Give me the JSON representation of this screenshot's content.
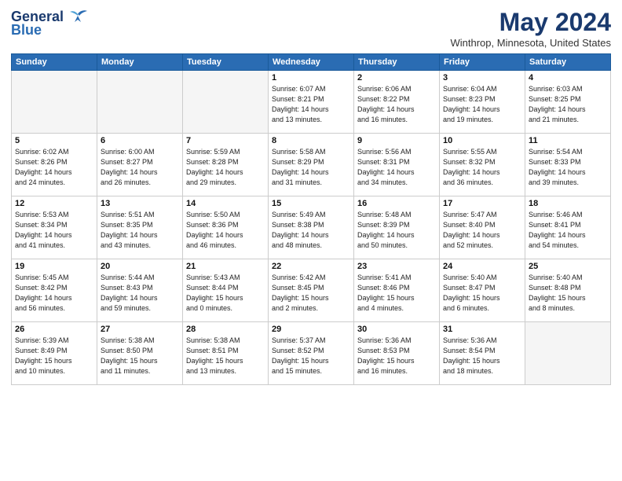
{
  "header": {
    "logo_general": "General",
    "logo_blue": "Blue",
    "month_title": "May 2024",
    "location": "Winthrop, Minnesota, United States"
  },
  "days_of_week": [
    "Sunday",
    "Monday",
    "Tuesday",
    "Wednesday",
    "Thursday",
    "Friday",
    "Saturday"
  ],
  "weeks": [
    [
      {
        "day": "",
        "empty": true
      },
      {
        "day": "",
        "empty": true
      },
      {
        "day": "",
        "empty": true
      },
      {
        "day": "1",
        "lines": [
          "Sunrise: 6:07 AM",
          "Sunset: 8:21 PM",
          "Daylight: 14 hours",
          "and 13 minutes."
        ]
      },
      {
        "day": "2",
        "lines": [
          "Sunrise: 6:06 AM",
          "Sunset: 8:22 PM",
          "Daylight: 14 hours",
          "and 16 minutes."
        ]
      },
      {
        "day": "3",
        "lines": [
          "Sunrise: 6:04 AM",
          "Sunset: 8:23 PM",
          "Daylight: 14 hours",
          "and 19 minutes."
        ]
      },
      {
        "day": "4",
        "lines": [
          "Sunrise: 6:03 AM",
          "Sunset: 8:25 PM",
          "Daylight: 14 hours",
          "and 21 minutes."
        ]
      }
    ],
    [
      {
        "day": "5",
        "lines": [
          "Sunrise: 6:02 AM",
          "Sunset: 8:26 PM",
          "Daylight: 14 hours",
          "and 24 minutes."
        ]
      },
      {
        "day": "6",
        "lines": [
          "Sunrise: 6:00 AM",
          "Sunset: 8:27 PM",
          "Daylight: 14 hours",
          "and 26 minutes."
        ]
      },
      {
        "day": "7",
        "lines": [
          "Sunrise: 5:59 AM",
          "Sunset: 8:28 PM",
          "Daylight: 14 hours",
          "and 29 minutes."
        ]
      },
      {
        "day": "8",
        "lines": [
          "Sunrise: 5:58 AM",
          "Sunset: 8:29 PM",
          "Daylight: 14 hours",
          "and 31 minutes."
        ]
      },
      {
        "day": "9",
        "lines": [
          "Sunrise: 5:56 AM",
          "Sunset: 8:31 PM",
          "Daylight: 14 hours",
          "and 34 minutes."
        ]
      },
      {
        "day": "10",
        "lines": [
          "Sunrise: 5:55 AM",
          "Sunset: 8:32 PM",
          "Daylight: 14 hours",
          "and 36 minutes."
        ]
      },
      {
        "day": "11",
        "lines": [
          "Sunrise: 5:54 AM",
          "Sunset: 8:33 PM",
          "Daylight: 14 hours",
          "and 39 minutes."
        ]
      }
    ],
    [
      {
        "day": "12",
        "lines": [
          "Sunrise: 5:53 AM",
          "Sunset: 8:34 PM",
          "Daylight: 14 hours",
          "and 41 minutes."
        ]
      },
      {
        "day": "13",
        "lines": [
          "Sunrise: 5:51 AM",
          "Sunset: 8:35 PM",
          "Daylight: 14 hours",
          "and 43 minutes."
        ]
      },
      {
        "day": "14",
        "lines": [
          "Sunrise: 5:50 AM",
          "Sunset: 8:36 PM",
          "Daylight: 14 hours",
          "and 46 minutes."
        ]
      },
      {
        "day": "15",
        "lines": [
          "Sunrise: 5:49 AM",
          "Sunset: 8:38 PM",
          "Daylight: 14 hours",
          "and 48 minutes."
        ]
      },
      {
        "day": "16",
        "lines": [
          "Sunrise: 5:48 AM",
          "Sunset: 8:39 PM",
          "Daylight: 14 hours",
          "and 50 minutes."
        ]
      },
      {
        "day": "17",
        "lines": [
          "Sunrise: 5:47 AM",
          "Sunset: 8:40 PM",
          "Daylight: 14 hours",
          "and 52 minutes."
        ]
      },
      {
        "day": "18",
        "lines": [
          "Sunrise: 5:46 AM",
          "Sunset: 8:41 PM",
          "Daylight: 14 hours",
          "and 54 minutes."
        ]
      }
    ],
    [
      {
        "day": "19",
        "lines": [
          "Sunrise: 5:45 AM",
          "Sunset: 8:42 PM",
          "Daylight: 14 hours",
          "and 56 minutes."
        ]
      },
      {
        "day": "20",
        "lines": [
          "Sunrise: 5:44 AM",
          "Sunset: 8:43 PM",
          "Daylight: 14 hours",
          "and 59 minutes."
        ]
      },
      {
        "day": "21",
        "lines": [
          "Sunrise: 5:43 AM",
          "Sunset: 8:44 PM",
          "Daylight: 15 hours",
          "and 0 minutes."
        ]
      },
      {
        "day": "22",
        "lines": [
          "Sunrise: 5:42 AM",
          "Sunset: 8:45 PM",
          "Daylight: 15 hours",
          "and 2 minutes."
        ]
      },
      {
        "day": "23",
        "lines": [
          "Sunrise: 5:41 AM",
          "Sunset: 8:46 PM",
          "Daylight: 15 hours",
          "and 4 minutes."
        ]
      },
      {
        "day": "24",
        "lines": [
          "Sunrise: 5:40 AM",
          "Sunset: 8:47 PM",
          "Daylight: 15 hours",
          "and 6 minutes."
        ]
      },
      {
        "day": "25",
        "lines": [
          "Sunrise: 5:40 AM",
          "Sunset: 8:48 PM",
          "Daylight: 15 hours",
          "and 8 minutes."
        ]
      }
    ],
    [
      {
        "day": "26",
        "lines": [
          "Sunrise: 5:39 AM",
          "Sunset: 8:49 PM",
          "Daylight: 15 hours",
          "and 10 minutes."
        ]
      },
      {
        "day": "27",
        "lines": [
          "Sunrise: 5:38 AM",
          "Sunset: 8:50 PM",
          "Daylight: 15 hours",
          "and 11 minutes."
        ]
      },
      {
        "day": "28",
        "lines": [
          "Sunrise: 5:38 AM",
          "Sunset: 8:51 PM",
          "Daylight: 15 hours",
          "and 13 minutes."
        ]
      },
      {
        "day": "29",
        "lines": [
          "Sunrise: 5:37 AM",
          "Sunset: 8:52 PM",
          "Daylight: 15 hours",
          "and 15 minutes."
        ]
      },
      {
        "day": "30",
        "lines": [
          "Sunrise: 5:36 AM",
          "Sunset: 8:53 PM",
          "Daylight: 15 hours",
          "and 16 minutes."
        ]
      },
      {
        "day": "31",
        "lines": [
          "Sunrise: 5:36 AM",
          "Sunset: 8:54 PM",
          "Daylight: 15 hours",
          "and 18 minutes."
        ]
      },
      {
        "day": "",
        "empty": true
      }
    ]
  ]
}
